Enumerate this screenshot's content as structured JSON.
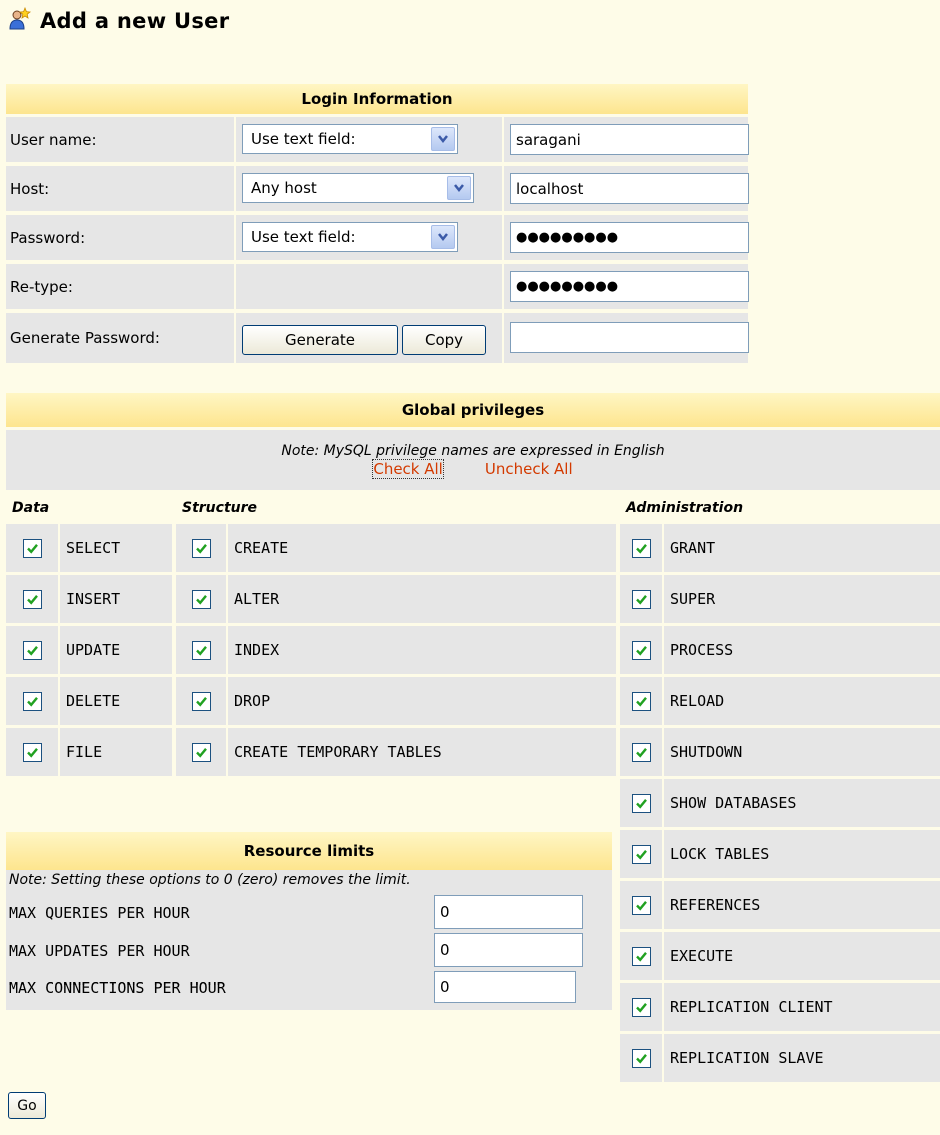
{
  "page": {
    "title": "Add a new User"
  },
  "login": {
    "header": "Login Information",
    "rows": [
      {
        "label": "User name:",
        "select": "Use text field:",
        "value": "saragani"
      },
      {
        "label": "Host:",
        "select": "Any host",
        "value": "localhost"
      },
      {
        "label": "Password:",
        "select": "Use text field:",
        "value": "●●●●●●●●●"
      },
      {
        "label": "Re-type:",
        "value": "●●●●●●●●●"
      },
      {
        "label": "Generate Password:",
        "generate": "Generate",
        "copy": "Copy",
        "value": ""
      }
    ]
  },
  "privileges": {
    "header": "Global privileges",
    "note": "Note: MySQL privilege names are expressed in English",
    "check_all": "Check All",
    "uncheck_all": "Uncheck All",
    "data_label": "Data",
    "structure_label": "Structure",
    "admin_label": "Administration",
    "data": [
      "SELECT",
      "INSERT",
      "UPDATE",
      "DELETE",
      "FILE"
    ],
    "structure": [
      "CREATE",
      "ALTER",
      "INDEX",
      "DROP",
      "CREATE TEMPORARY TABLES"
    ],
    "admin": [
      "GRANT",
      "SUPER",
      "PROCESS",
      "RELOAD",
      "SHUTDOWN",
      "SHOW DATABASES",
      "LOCK TABLES",
      "REFERENCES",
      "EXECUTE",
      "REPLICATION CLIENT",
      "REPLICATION SLAVE"
    ]
  },
  "resources": {
    "header": "Resource limits",
    "note": "Note: Setting these options to 0 (zero) removes the limit.",
    "rows": [
      {
        "label": "MAX QUERIES PER HOUR",
        "value": "0"
      },
      {
        "label": "MAX UPDATES PER HOUR",
        "value": "0"
      },
      {
        "label": "MAX CONNECTIONS PER HOUR",
        "value": "0"
      }
    ]
  },
  "go_label": "Go",
  "colors": {
    "header_bg": "#fde58e",
    "cell_bg": "#e6e6e6",
    "link": "#d33a00",
    "page_bg": "#fefce8",
    "check": "#21a121"
  },
  "icons": {
    "title": "add-user-icon",
    "dropdown": "chevron-down-icon",
    "checkbox": "checkmark-icon"
  }
}
